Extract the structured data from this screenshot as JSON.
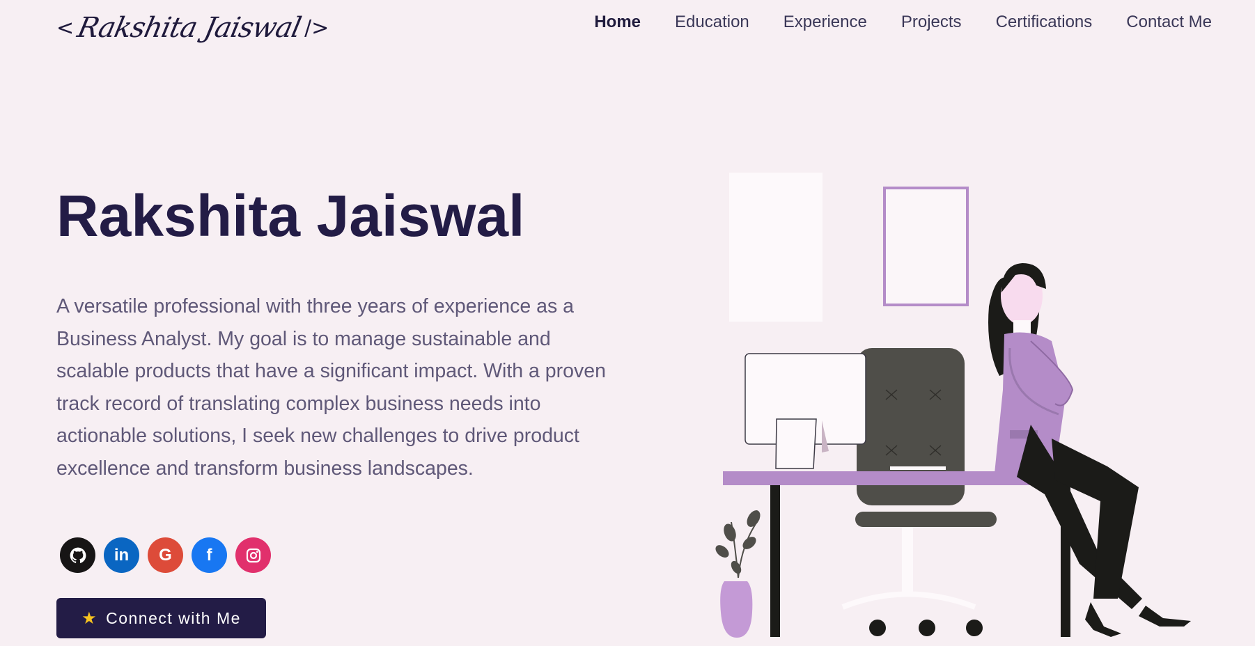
{
  "header": {
    "logo_open": "<",
    "logo_signature": "Rakshita Jaiswal",
    "logo_close": "/>",
    "nav": [
      {
        "label": "Home",
        "active": true
      },
      {
        "label": "Education",
        "active": false
      },
      {
        "label": "Experience",
        "active": false
      },
      {
        "label": "Projects",
        "active": false
      },
      {
        "label": "Certifications",
        "active": false
      },
      {
        "label": "Contact Me",
        "active": false
      }
    ]
  },
  "hero": {
    "name": "Rakshita Jaiswal",
    "description": "A versatile professional with three years of experience as a Business Analyst. My goal is to manage sustainable and scalable products that have a significant impact. With a proven track record of translating complex business needs into actionable solutions, I seek new challenges to drive product excellence and transform business landscapes."
  },
  "socials": [
    {
      "name": "github-icon",
      "glyph": "◉",
      "color": "#171515"
    },
    {
      "name": "linkedin-icon",
      "glyph": "in",
      "color": "#0a66c2"
    },
    {
      "name": "google-icon",
      "glyph": "G",
      "color": "#dd4b39"
    },
    {
      "name": "facebook-icon",
      "glyph": "f",
      "color": "#1877f2"
    },
    {
      "name": "instagram-icon",
      "glyph": "◎",
      "color": "#e1306c"
    }
  ],
  "cta": {
    "icon": "star-icon",
    "label": "Connect with Me"
  },
  "colors": {
    "background": "#f7eff3",
    "primary": "#231c46",
    "text_muted": "#5f5878",
    "accent_purple": "#b48cc8"
  }
}
